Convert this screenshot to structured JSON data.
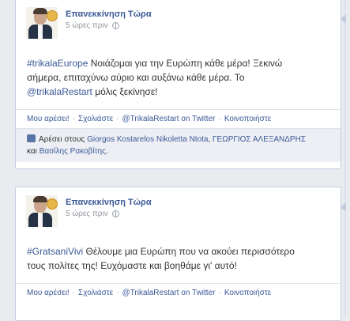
{
  "posts": [
    {
      "author": "Επανεκκίνηση Τώρα",
      "time": "5 ώρες πριν",
      "hashtag": "#trikalaEurope",
      "text_line1": " Νοιάζομαι για την Ευρώπη κάθε μέρα! Ξεκινώ",
      "text_line2": "σήμερα, επιταχύνω αύριο και αυξάνω κάθε μέρα. Το",
      "mention": "@trikalaRestart",
      "text_line3": " μόλις ξεκίνησε!",
      "actions": {
        "like": "Μου αρέσει!",
        "comment": "Σχολιάστε",
        "twitter": "@TrikalaRestart on Twitter",
        "share": "Κοινοποιήστε",
        "separator": "·"
      },
      "likes": {
        "prefix": "Αρέσει στους",
        "person1": "Giorgos Kostarelos",
        "person2": "Nikoletta Ntota",
        "person3": "ΓΕΩΡΓΙΟΣ ΑΛΕΞΑΝΔΡΗΣ",
        "connector": "και",
        "person4": "Βασίλης Ρακοβίτης",
        "suffix": "."
      }
    },
    {
      "author": "Επανεκκίνηση Τώρα",
      "time": "5 ώρες πριν",
      "hashtag": "#GratsaniVivi",
      "text_line1": " Θέλουμε μια Ευρώπη που να ακούει περισσότερο",
      "text_line2": "τους πολίτες της! Ευχόμαστε και βοηθάμε γι' αυτό!",
      "actions": {
        "like": "Μου αρέσει!",
        "comment": "Σχολιάστε",
        "twitter": "@TrikalaRestart on Twitter",
        "share": "Κοινοποιήστε",
        "separator": "·"
      }
    }
  ],
  "icons": {
    "privacy": "globe-icon",
    "like": "thumbs-up-icon"
  },
  "colors": {
    "link": "#3b5998",
    "background": "#e9ebee",
    "likes_bar": "#edeff4"
  }
}
